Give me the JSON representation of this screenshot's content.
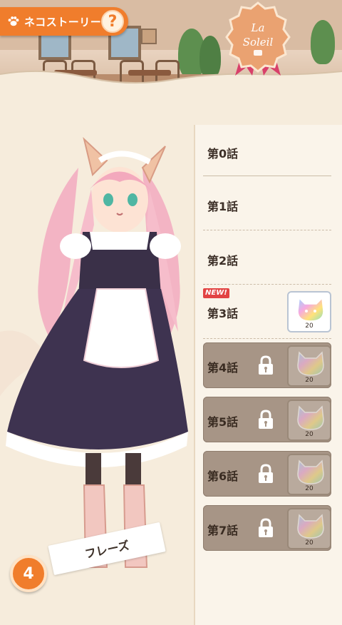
{
  "header": {
    "title": "ネコストーリー",
    "help_label": "?"
  },
  "emblem": {
    "line1": "La",
    "line2": "Soleil"
  },
  "chapters": [
    {
      "label": "第0話",
      "locked": false,
      "reward": null
    },
    {
      "label": "第1話",
      "locked": false,
      "reward": null
    },
    {
      "label": "第2話",
      "locked": false,
      "reward": null
    },
    {
      "label": "第3話",
      "locked": false,
      "new": "NEW!",
      "reward": {
        "icon": "rainbow-cat-gem-icon",
        "count": "20"
      }
    },
    {
      "label": "第4話",
      "locked": true,
      "reward": {
        "icon": "rainbow-cat-gem-icon",
        "count": "20"
      }
    },
    {
      "label": "第5話",
      "locked": true,
      "reward": {
        "icon": "rainbow-cat-gem-icon",
        "count": "20"
      }
    },
    {
      "label": "第6話",
      "locked": true,
      "reward": {
        "icon": "rainbow-cat-gem-icon",
        "count": "20"
      }
    },
    {
      "label": "第7話",
      "locked": true,
      "reward": {
        "icon": "rainbow-cat-gem-icon",
        "count": "20"
      }
    }
  ],
  "character": {
    "level": "4",
    "name": "フレーズ"
  },
  "colors": {
    "accent": "#f07d2c",
    "locked": "#a79586",
    "new_badge": "#e24343"
  }
}
